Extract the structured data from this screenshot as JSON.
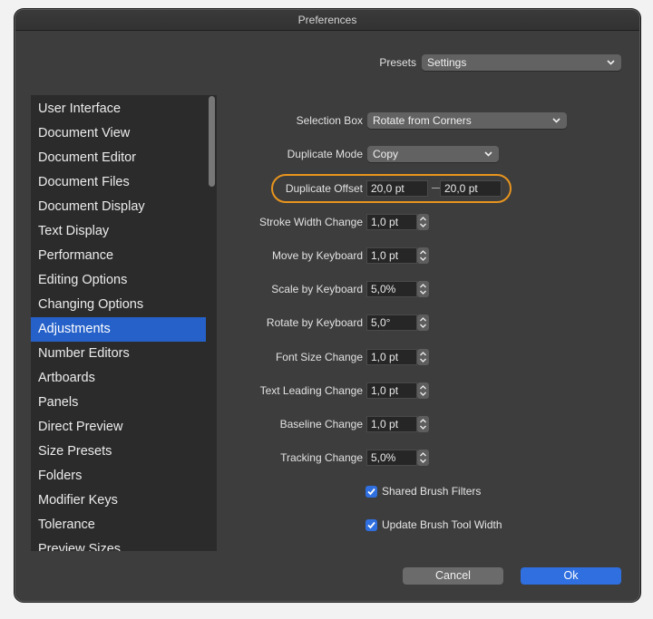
{
  "window": {
    "title": "Preferences"
  },
  "presets": {
    "label": "Presets",
    "value": "Settings"
  },
  "sidebar": {
    "items": [
      {
        "label": "User Interface"
      },
      {
        "label": "Document View"
      },
      {
        "label": "Document Editor"
      },
      {
        "label": "Document Files"
      },
      {
        "label": "Document Display"
      },
      {
        "label": "Text Display"
      },
      {
        "label": "Performance"
      },
      {
        "label": "Editing Options"
      },
      {
        "label": "Changing Options"
      },
      {
        "label": "Adjustments",
        "selected": true
      },
      {
        "label": "Number Editors"
      },
      {
        "label": "Artboards"
      },
      {
        "label": "Panels"
      },
      {
        "label": "Direct Preview"
      },
      {
        "label": "Size Presets"
      },
      {
        "label": "Folders"
      },
      {
        "label": "Modifier Keys"
      },
      {
        "label": "Tolerance"
      },
      {
        "label": "Preview Sizes"
      }
    ]
  },
  "settings": {
    "selection_box": {
      "label": "Selection Box",
      "value": "Rotate from Corners"
    },
    "duplicate_mode": {
      "label": "Duplicate Mode",
      "value": "Copy"
    },
    "duplicate_offset": {
      "label": "Duplicate Offset",
      "x": "20,0 pt",
      "y": "20,0 pt"
    },
    "stroke_width_change": {
      "label": "Stroke Width Change",
      "value": "1,0 pt"
    },
    "move_by_keyboard": {
      "label": "Move by Keyboard",
      "value": "1,0 pt"
    },
    "scale_by_keyboard": {
      "label": "Scale by Keyboard",
      "value": "5,0%"
    },
    "rotate_by_keyboard": {
      "label": "Rotate by Keyboard",
      "value": "5,0°"
    },
    "font_size_change": {
      "label": "Font Size Change",
      "value": "1,0 pt"
    },
    "text_leading_change": {
      "label": "Text Leading Change",
      "value": "1,0 pt"
    },
    "baseline_change": {
      "label": "Baseline Change",
      "value": "1,0 pt"
    },
    "tracking_change": {
      "label": "Tracking Change",
      "value": "5,0%"
    },
    "shared_brush_filters": {
      "label": "Shared Brush Filters",
      "checked": true
    },
    "update_brush_tool_width": {
      "label": "Update Brush Tool Width",
      "checked": true
    }
  },
  "buttons": {
    "cancel": "Cancel",
    "ok": "Ok"
  },
  "colors": {
    "accent": "#2f6fe0",
    "selection": "#2561c9",
    "highlight_ring": "#e8951e",
    "window_bg": "#3d3d3d"
  }
}
